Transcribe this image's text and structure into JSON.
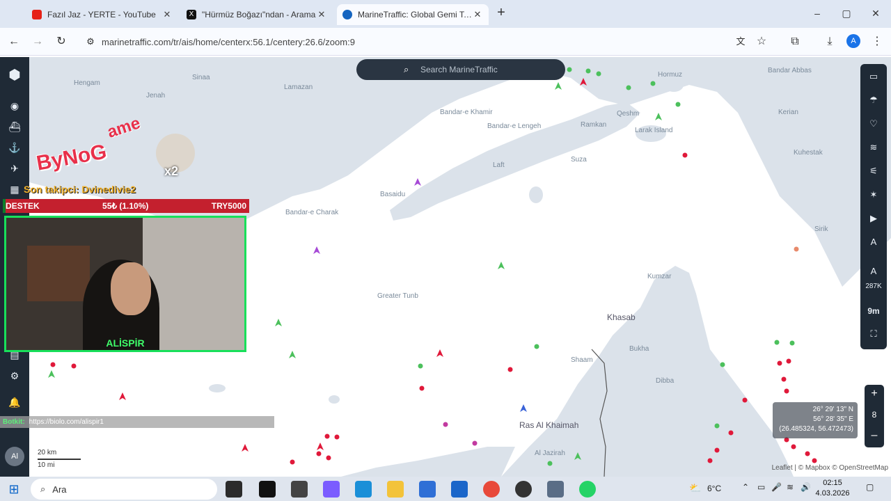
{
  "browser": {
    "tabs": [
      {
        "title": "Fazıl Jaz - YERTE - YouTube",
        "active": false,
        "favicon_color": "#e62117"
      },
      {
        "title": "\"Hürmüz Boğazı\"ndan - Arama",
        "active": false,
        "favicon_color": "#111111"
      },
      {
        "title": "MarineTraffic: Global Gemi Takip",
        "active": true,
        "favicon_color": "#1565c0"
      }
    ],
    "new_tab_label": "+",
    "window_controls": {
      "minimize": "–",
      "maximize": "▢",
      "close": "✕"
    },
    "url": "marinetraffic.com/tr/ais/home/centerx:56.1/centery:26.6/zoom:9",
    "profile_initial": "A"
  },
  "map": {
    "search_placeholder": "Search MarineTraffic",
    "places": [
      {
        "name": "Hormuz",
        "big": false
      },
      {
        "name": "Bandar Abbas",
        "big": false
      },
      {
        "name": "Bandar-e Khamir",
        "big": false
      },
      {
        "name": "Bandar-e Lengeh",
        "big": false
      },
      {
        "name": "Qeshm",
        "big": false
      },
      {
        "name": "Laft",
        "big": false
      },
      {
        "name": "Ramkan",
        "big": false
      },
      {
        "name": "Larak Island",
        "big": false
      },
      {
        "name": "Suza",
        "big": false
      },
      {
        "name": "Basaidu",
        "big": false
      },
      {
        "name": "Greater Tunb",
        "big": false
      },
      {
        "name": "Khasab",
        "big": true
      },
      {
        "name": "Kumzar",
        "big": false
      },
      {
        "name": "Bukha",
        "big": false
      },
      {
        "name": "Dibba",
        "big": false
      },
      {
        "name": "Ras Al Khaimah",
        "big": true
      },
      {
        "name": "Al Jazirah",
        "big": false
      },
      {
        "name": "Sirik",
        "big": false
      },
      {
        "name": "Kuhestak",
        "big": false
      },
      {
        "name": "Kerian",
        "big": false
      },
      {
        "name": "Lamazan",
        "big": false
      },
      {
        "name": "Jenah",
        "big": false
      },
      {
        "name": "Bandar-e Charak",
        "big": false
      },
      {
        "name": "Sinaa",
        "big": false
      },
      {
        "name": "Shaam",
        "big": false
      },
      {
        "name": "Hengam",
        "big": false
      }
    ],
    "coordinates": {
      "lat": "26° 29' 13\" N",
      "lon": "56° 28' 35\" E",
      "decimal": "(26.485324, 56.472473)"
    },
    "scale": {
      "km": "20 km",
      "mi": "10 mi"
    },
    "attribution": "Leaflet | © Mapbox © OpenStreetMap",
    "zoom_level": "8",
    "right_rail": {
      "vessel_count": "287K",
      "label_9m": "9m"
    }
  },
  "stream_overlay": {
    "logo_text": "ByNoG",
    "logo_game": "ame",
    "logo_badge": "x2",
    "last_follower": "Son takipci: Dvinedivie2",
    "donation": {
      "label": "DESTEK",
      "progress": "55₺ (1.10%)",
      "goal": "TRY5000",
      "fraction": 0.011
    },
    "cam_name": "ALİSPİR",
    "bot_name": "Botkit:",
    "bot_link": "https://biolo.com/alispir1"
  },
  "left_rail": {
    "user_initials": "Al"
  },
  "taskbar": {
    "search_label": "Ara",
    "weather": "6°C",
    "time": "02:15",
    "date": "4.03.2026"
  },
  "colors": {
    "rail_bg": "#1f2a36",
    "sea": "#ffffff",
    "land": "#dbe2ea",
    "vessel_red": "#e0193a",
    "vessel_green": "#4cc05c",
    "cam_border": "#18e05a"
  }
}
